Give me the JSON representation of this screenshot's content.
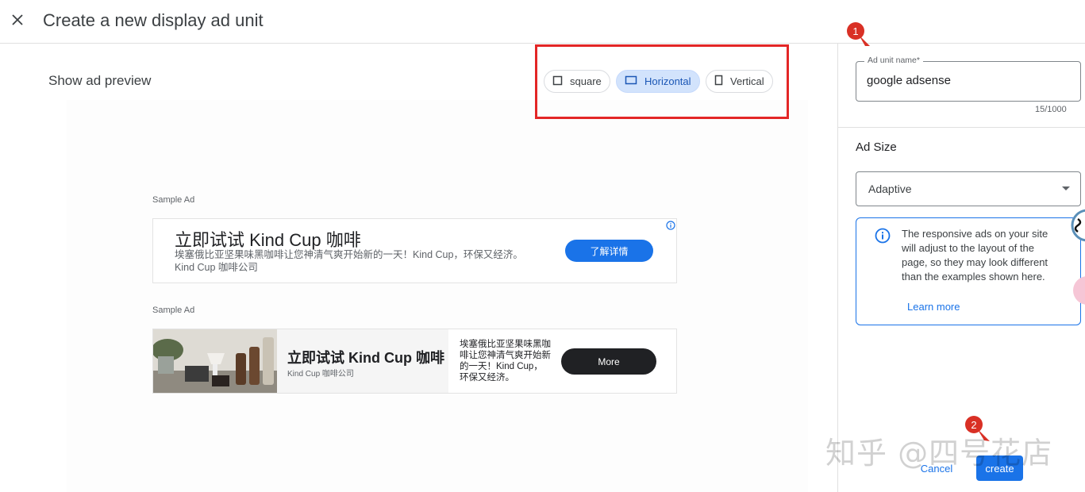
{
  "header": {
    "title": "Create a new display ad unit"
  },
  "preview": {
    "label": "Show ad preview",
    "shapes": [
      {
        "label": "square",
        "icon": "square-icon",
        "selected": false
      },
      {
        "label": "Horizontal",
        "icon": "horizontal-rect-icon",
        "selected": true
      },
      {
        "label": "Vertical",
        "icon": "vertical-rect-icon",
        "selected": false
      }
    ],
    "ads": [
      {
        "sample_label": "Sample Ad",
        "title": "立即试试 Kind Cup 咖啡",
        "description": "埃塞俄比亚坚果味黑咖啡让您神清气爽开始新的一天！Kind Cup，环保又经济。",
        "advertiser": "Kind Cup 咖啡公司",
        "cta": "了解详情"
      },
      {
        "sample_label": "Sample Ad",
        "title": "立即试试 Kind Cup 咖啡",
        "advertiser": "Kind Cup 咖啡公司",
        "description": "埃塞俄比亚坚果味黑咖啡让您神清气爽开始新的一天！Kind Cup，环保又经济。",
        "cta": "More"
      }
    ]
  },
  "settings": {
    "name_field": {
      "label": "Ad unit name*",
      "value": "google adsense",
      "counter": "15/1000"
    },
    "ad_size": {
      "label": "Ad Size",
      "selected": "Adaptive"
    },
    "info": {
      "text": "The responsive ads on your site will adjust to the layout of the page, so they may look different than the examples shown here.",
      "link": "Learn more"
    },
    "actions": {
      "cancel": "Cancel",
      "create": "create"
    }
  },
  "annotations": {
    "marker_1": "1",
    "marker_2": "2"
  },
  "watermark": "知乎 @四号花店",
  "colors": {
    "accent": "#1a73e8",
    "highlight": "#e32626",
    "selected_chip": "#d2e3fc"
  }
}
